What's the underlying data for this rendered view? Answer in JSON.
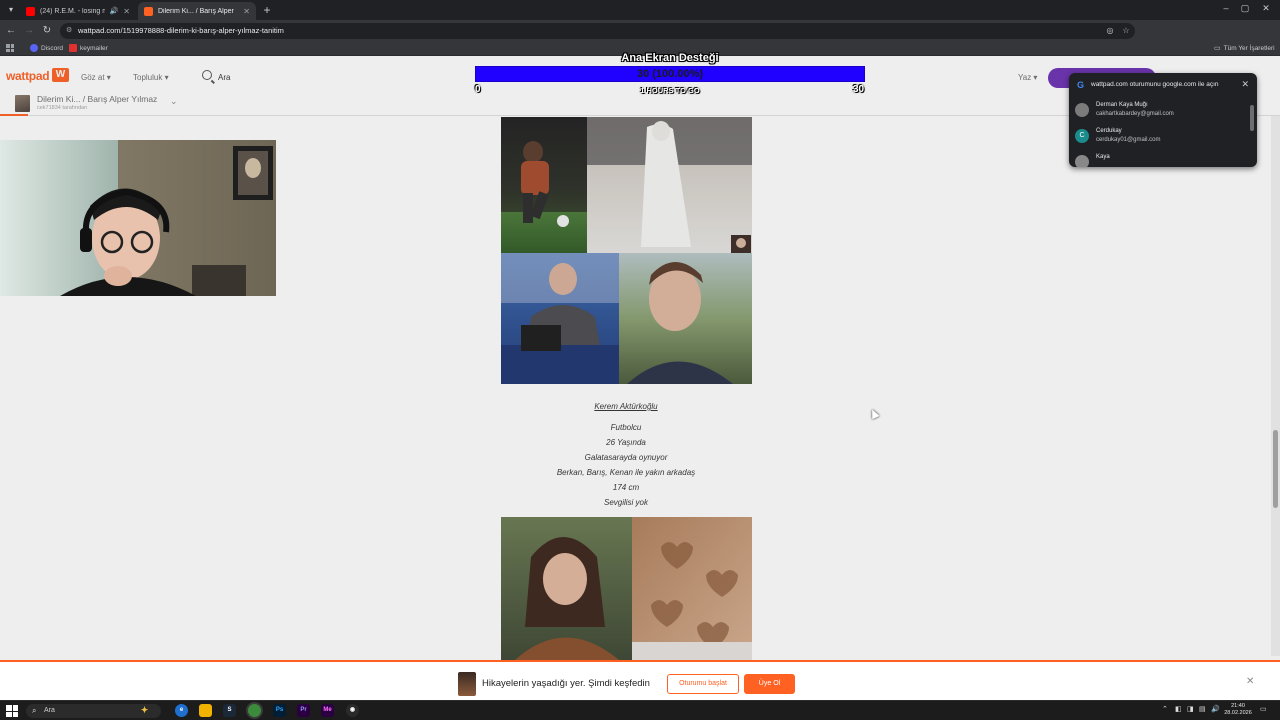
{
  "browser": {
    "tabs": [
      {
        "label": "(24) R.E.M. - losing my relig",
        "active": false,
        "favicon_color": "#ff0000"
      },
      {
        "label": "Dilerim Ki... / Barış Alper Yılmaz",
        "active": true,
        "favicon_color": "#ff6122"
      }
    ],
    "new_tab": "+",
    "window_controls": [
      "–",
      "▢",
      "✕"
    ],
    "address": "wattpad.com/1519978888-dilerim-ki-barış-alper-yılmaz-tanitim",
    "bookmarks": [
      {
        "label": "Discord",
        "color": "#5865f2"
      },
      {
        "label": "keymailer",
        "color": "#e03030"
      }
    ],
    "all_bookmarks": "Tüm Yer İşaretleri"
  },
  "wattpad": {
    "logo": "wattpad",
    "nav": {
      "browse": "Göz at ▾",
      "community": "Topluluk ▾",
      "search": "Ara",
      "write": "Yaz ▾"
    },
    "story": {
      "title": "Dilerim Ki... / Barış Alper Yılmaz",
      "author": "cek71834 tarafından"
    },
    "profile_lines": [
      "Kerem Aktürkoğlu",
      "Futbolcu",
      "26 Yaşında",
      "Galatasarayda oynuyor",
      "Berkan, Barış, Kenan ile yakın arkadaş",
      "174 cm",
      "Sevgilisi yok"
    ]
  },
  "stream_overlay": {
    "title": "Ana Ekran Desteği",
    "goal_text": "30 (100.00%)",
    "goal_progress": 1.0,
    "min": "0",
    "max": "30",
    "center_label": "1 HOURS TO GO"
  },
  "google_popup": {
    "title": "wattpad.com oturumunu google.com ile açın",
    "accounts": [
      {
        "name": "Derman Kaya Muğı",
        "email": "cakhartkabardey@gmail.com",
        "initial": "",
        "color": "#7b7b7b"
      },
      {
        "name": "Cerdukay",
        "email": "cerdukay01@gmail.com",
        "initial": "C",
        "color": "#1a8c8c"
      },
      {
        "name": "Kaya",
        "email": "",
        "initial": "",
        "color": "#888888"
      }
    ]
  },
  "cookie_banner": {
    "text": "Hikayelerin yaşadığı yer. Şimdi keşfedin",
    "login_label": "Oturumu başlat",
    "signup_label": "Üye Ol"
  },
  "taskbar": {
    "search": "Ara",
    "time": "21:40",
    "date": "28.02.2026"
  }
}
